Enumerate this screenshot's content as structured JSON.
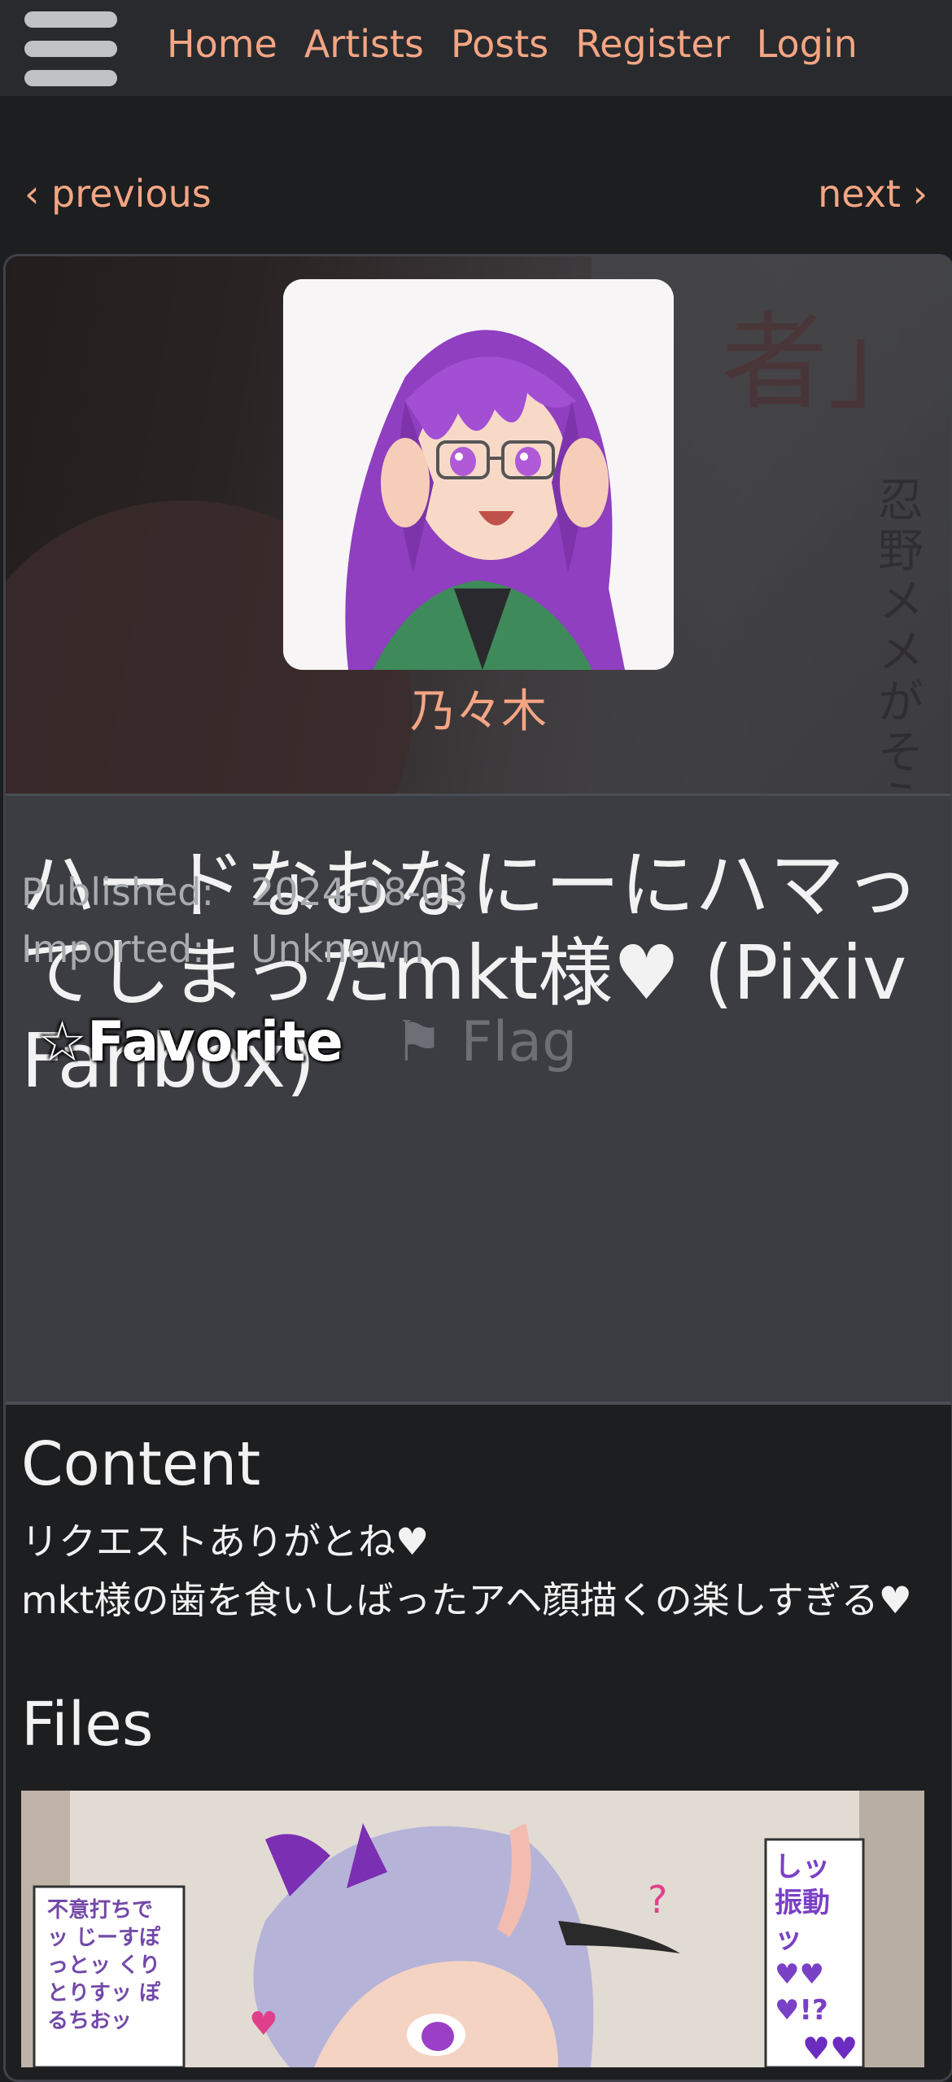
{
  "nav": {
    "links": [
      "Home",
      "Artists",
      "Posts",
      "Register",
      "Login"
    ]
  },
  "paginator": {
    "previous": "‹ previous",
    "next": "next ›"
  },
  "artist": {
    "name": "乃々木"
  },
  "post": {
    "title": "ハードなおなにーにハマってしまったmkt様♥ (Pixiv Fanbox)",
    "published_label": "Published:",
    "published_value": "2024-08-03",
    "imported_label": "Imported:",
    "imported_value": "Unknown",
    "favorite_label": "☆Favorite",
    "flag_label": "⚑ Flag"
  },
  "content": {
    "heading": "Content",
    "lines": [
      "リクエストありがとね♥",
      "mkt様の歯を食いしばったアヘ顔描くの楽しすぎる♥"
    ]
  },
  "files": {
    "heading": "Files"
  },
  "banner_text": {
    "large": "者」",
    "vertical": "忍野メメがそうい"
  },
  "file_image_text": {
    "left_box": "不意打ちでッ じーすぽっとッ くりとりすッ ぽるちおッ",
    "right_box": "しッ 振動ッ ♥♥ ♥!?"
  },
  "colors": {
    "accent_link": "#f4a583",
    "page_bg": "#1d1e20",
    "navbar_bg": "#282a2e",
    "header_panel": "#3b3d42"
  }
}
